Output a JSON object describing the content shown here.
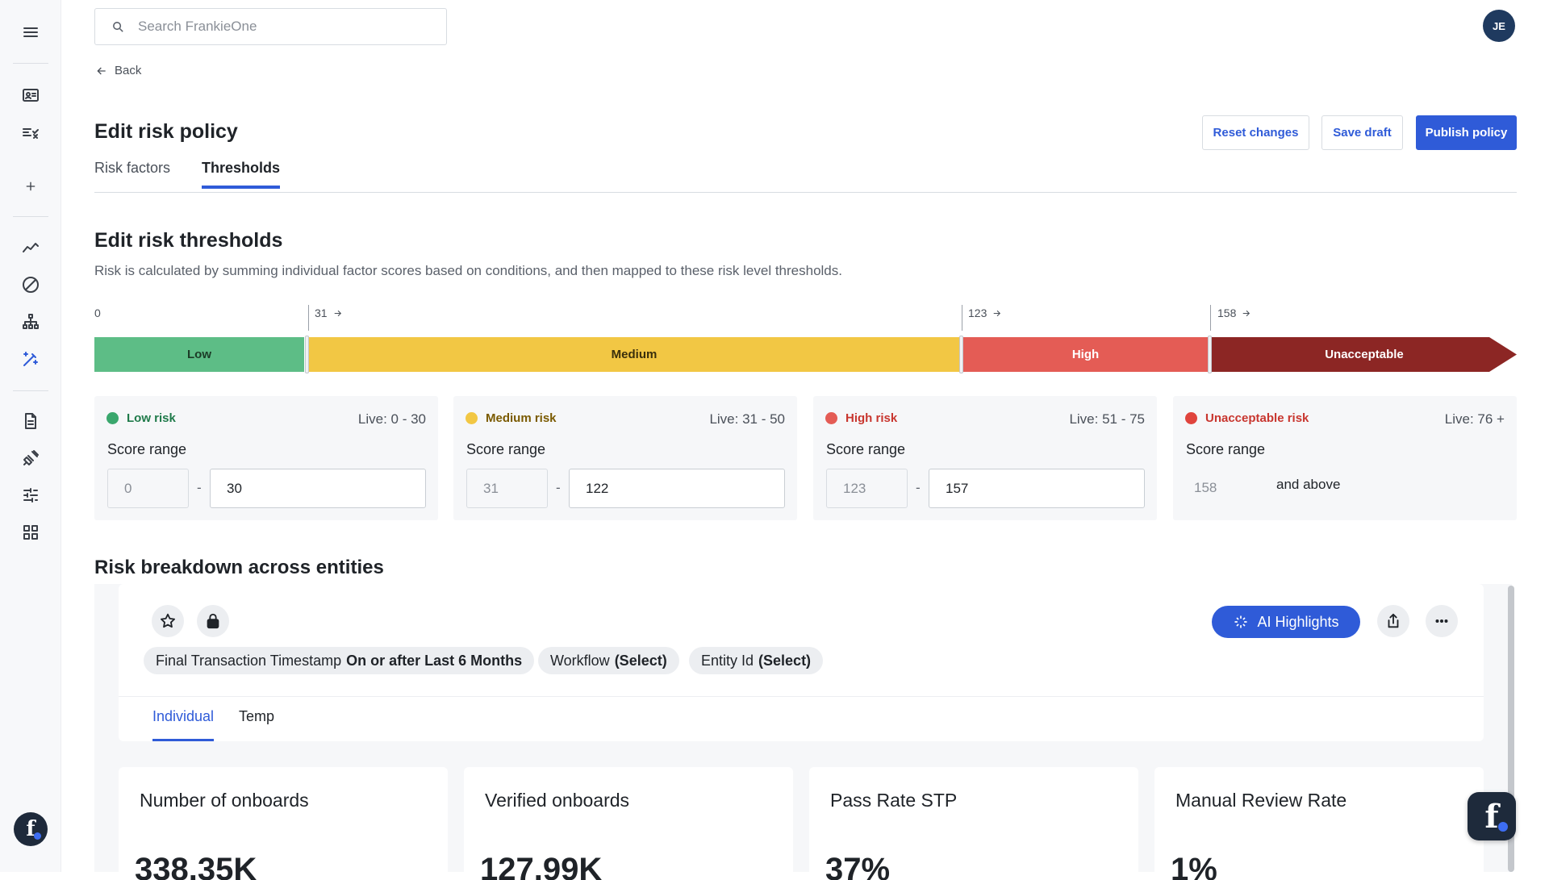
{
  "search": {
    "placeholder": "Search FrankieOne"
  },
  "user": {
    "initials": "JE"
  },
  "nav": {
    "back_label": "Back"
  },
  "page": {
    "title": "Edit risk policy",
    "actions": {
      "reset": "Reset changes",
      "save": "Save draft",
      "publish": "Publish policy"
    },
    "tabs": [
      {
        "label": "Risk factors",
        "active": false
      },
      {
        "label": "Thresholds",
        "active": true
      }
    ]
  },
  "thresholds": {
    "heading": "Edit risk thresholds",
    "description": "Risk is calculated by summing individual factor scores based on conditions, and then mapped to these risk level thresholds.",
    "scale_ticks": [
      "0",
      "31",
      "123",
      "158"
    ],
    "segments": [
      "Low",
      "Medium",
      "High",
      "Unacceptable"
    ],
    "levels": [
      {
        "name": "Low risk",
        "color": "#3aa76d",
        "text_color": "#1f7a4a",
        "live": "Live: 0 - 30",
        "score_label": "Score range",
        "min": "0",
        "max": "30"
      },
      {
        "name": "Medium risk",
        "color": "#f2c744",
        "text_color": "#7a5a00",
        "live": "Live: 31 - 50",
        "score_label": "Score range",
        "min": "31",
        "max": "122"
      },
      {
        "name": "High risk",
        "color": "#e45c55",
        "text_color": "#c8362f",
        "live": "Live: 51 - 75",
        "score_label": "Score range",
        "min": "123",
        "max": "157"
      },
      {
        "name": "Unacceptable risk",
        "color": "#e0443d",
        "text_color": "#c8362f",
        "live": "Live: 76 +",
        "score_label": "Score range",
        "min": "158",
        "max_text": "and above"
      }
    ]
  },
  "breakdown": {
    "heading": "Risk breakdown across entities",
    "ai_button": "AI Highlights",
    "filters": [
      {
        "field": "Final Transaction Timestamp",
        "value": "On or after Last 6 Months"
      },
      {
        "field": "Workflow",
        "value": "(Select)"
      },
      {
        "field": "Entity Id",
        "value": "(Select)"
      }
    ],
    "tabs": [
      {
        "label": "Individual",
        "active": true
      },
      {
        "label": "Temp",
        "active": false
      }
    ],
    "kpis": [
      {
        "title": "Number of onboards",
        "value": "338.35K"
      },
      {
        "title": "Verified onboards",
        "value": "127.99K"
      },
      {
        "title": "Pass Rate STP",
        "value": "37%"
      },
      {
        "title": "Manual Review Rate",
        "value": "1%"
      }
    ]
  },
  "colors": {
    "accent": "#2f5bd8",
    "low": "#5dbd86",
    "medium": "#f2c744",
    "high": "#e45c55",
    "unacceptable": "#8c2624"
  }
}
